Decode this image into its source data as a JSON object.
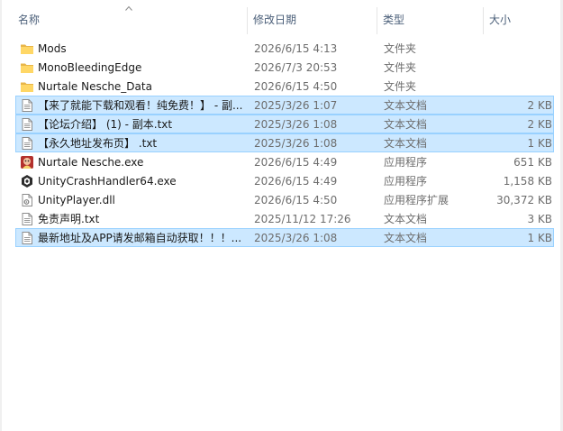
{
  "columns": {
    "name": "名称",
    "date": "修改日期",
    "type": "类型",
    "size": "大小"
  },
  "files": [
    {
      "name": "Mods",
      "date": "2026/6/15 4:13",
      "type": "文件夹",
      "size": "",
      "icon": "folder-icon",
      "selected": false
    },
    {
      "name": "MonoBleedingEdge",
      "date": "2026/7/3 20:53",
      "type": "文件夹",
      "size": "",
      "icon": "folder-icon",
      "selected": false
    },
    {
      "name": "Nurtale Nesche_Data",
      "date": "2026/6/15 4:50",
      "type": "文件夹",
      "size": "",
      "icon": "folder-icon",
      "selected": false
    },
    {
      "name": "【来了就能下载和观看！纯免费！】 - 副...",
      "date": "2025/3/26 1:07",
      "type": "文本文档",
      "size": "2 KB",
      "icon": "text-file-icon",
      "selected": true
    },
    {
      "name": "【论坛介绍】 (1) - 副本.txt",
      "date": "2025/3/26 1:08",
      "type": "文本文档",
      "size": "2 KB",
      "icon": "text-file-icon",
      "selected": true
    },
    {
      "name": "【永久地址发布页】 .txt",
      "date": "2025/3/26 1:08",
      "type": "文本文档",
      "size": "1 KB",
      "icon": "text-file-icon",
      "selected": true
    },
    {
      "name": "Nurtale Nesche.exe",
      "date": "2026/6/15 4:49",
      "type": "应用程序",
      "size": "651 KB",
      "icon": "game-exe-icon",
      "selected": false
    },
    {
      "name": "UnityCrashHandler64.exe",
      "date": "2026/6/15 4:49",
      "type": "应用程序",
      "size": "1,158 KB",
      "icon": "unity-icon",
      "selected": false
    },
    {
      "name": "UnityPlayer.dll",
      "date": "2026/6/15 4:50",
      "type": "应用程序扩展",
      "size": "30,372 KB",
      "icon": "dll-file-icon",
      "selected": false
    },
    {
      "name": "免责声明.txt",
      "date": "2025/11/12 17:26",
      "type": "文本文档",
      "size": "3 KB",
      "icon": "text-file-icon",
      "selected": false
    },
    {
      "name": "最新地址及APP请发邮箱自动获取！！！...",
      "date": "2025/3/26 1:08",
      "type": "文本文档",
      "size": "1 KB",
      "icon": "text-file-icon",
      "selected": true
    }
  ]
}
